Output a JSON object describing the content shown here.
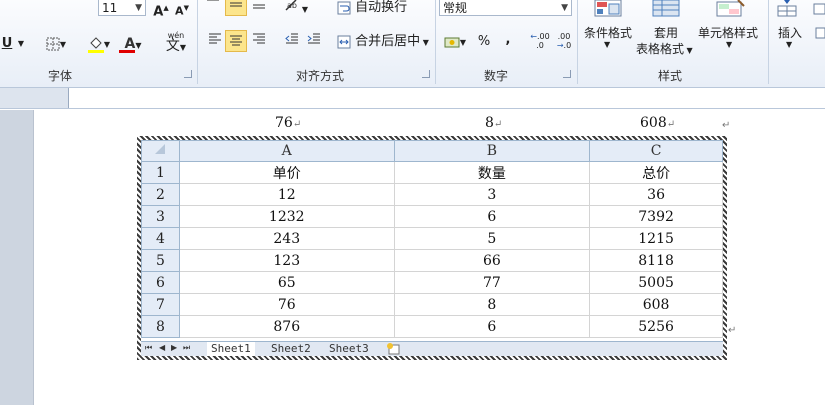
{
  "ribbon": {
    "font_size": "11",
    "font_grow": "A",
    "font_shrink": "A",
    "underline": "U",
    "font_color_letter": "A",
    "phonetic": "wén",
    "phonetic_char": "文",
    "wrap_text": "自动换行",
    "merge_center": "合并后居中",
    "number_format": "常规",
    "percent": "%",
    "comma": ",",
    "inc_decimal": ".00",
    "dec_decimal": ".00",
    "conditional_format": "条件格式",
    "table_format_1": "套用",
    "table_format_2": "表格格式",
    "cell_styles": "单元格样式",
    "insert": "插入",
    "groups": {
      "font": "字体",
      "alignment": "对齐方式",
      "number": "数字",
      "styles": "样式"
    }
  },
  "top_values": [
    "76",
    "8",
    "608"
  ],
  "sheet": {
    "col_headers": [
      "A",
      "B",
      "C"
    ],
    "rows": [
      {
        "num": "1",
        "cells": [
          "单价",
          "数量",
          "总价"
        ]
      },
      {
        "num": "2",
        "cells": [
          "12",
          "3",
          "36"
        ]
      },
      {
        "num": "3",
        "cells": [
          "1232",
          "6",
          "7392"
        ]
      },
      {
        "num": "4",
        "cells": [
          "243",
          "5",
          "1215"
        ]
      },
      {
        "num": "5",
        "cells": [
          "123",
          "66",
          "8118"
        ]
      },
      {
        "num": "6",
        "cells": [
          "65",
          "77",
          "5005"
        ]
      },
      {
        "num": "7",
        "cells": [
          "76",
          "8",
          "608"
        ]
      },
      {
        "num": "8",
        "cells": [
          "876",
          "6",
          "5256"
        ]
      }
    ],
    "tabs": [
      "Sheet1",
      "Sheet2",
      "Sheet3"
    ],
    "active_tab": "Sheet1"
  },
  "colors": {
    "ribbon_bg": "#e8eef7",
    "active_button": "#fce58c",
    "header_bg": "#e4ecf7"
  }
}
